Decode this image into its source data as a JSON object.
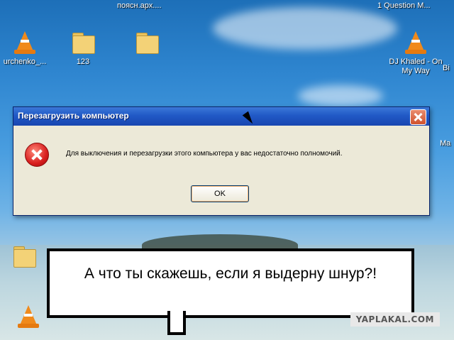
{
  "desktop": {
    "top_labels": [
      "поясн.арх....",
      "1 Question M...",
      "Bi"
    ],
    "icons": [
      {
        "label": "urchenko_...",
        "type": "vlc"
      },
      {
        "label": "123",
        "type": "folder"
      },
      {
        "label": "",
        "type": "folder"
      },
      {
        "label": "DJ Khaled - On My Way",
        "type": "vlc"
      },
      {
        "label": "Ma",
        "type": "folder"
      }
    ]
  },
  "dialog": {
    "title": "Перезагрузить компьютер",
    "message": "Для выключения и перезагрузки этого компьютера у вас недостаточно полномочий.",
    "ok_label": "OK"
  },
  "speech_bubble": {
    "text": "А что ты скажешь, если я выдерну шнур?!"
  },
  "watermark": {
    "text": "YAPLAKAL.COM"
  },
  "colors": {
    "title_bar": "#2159c6",
    "dialog_bg": "#ece9d8",
    "error_red": "#d81e1e"
  }
}
